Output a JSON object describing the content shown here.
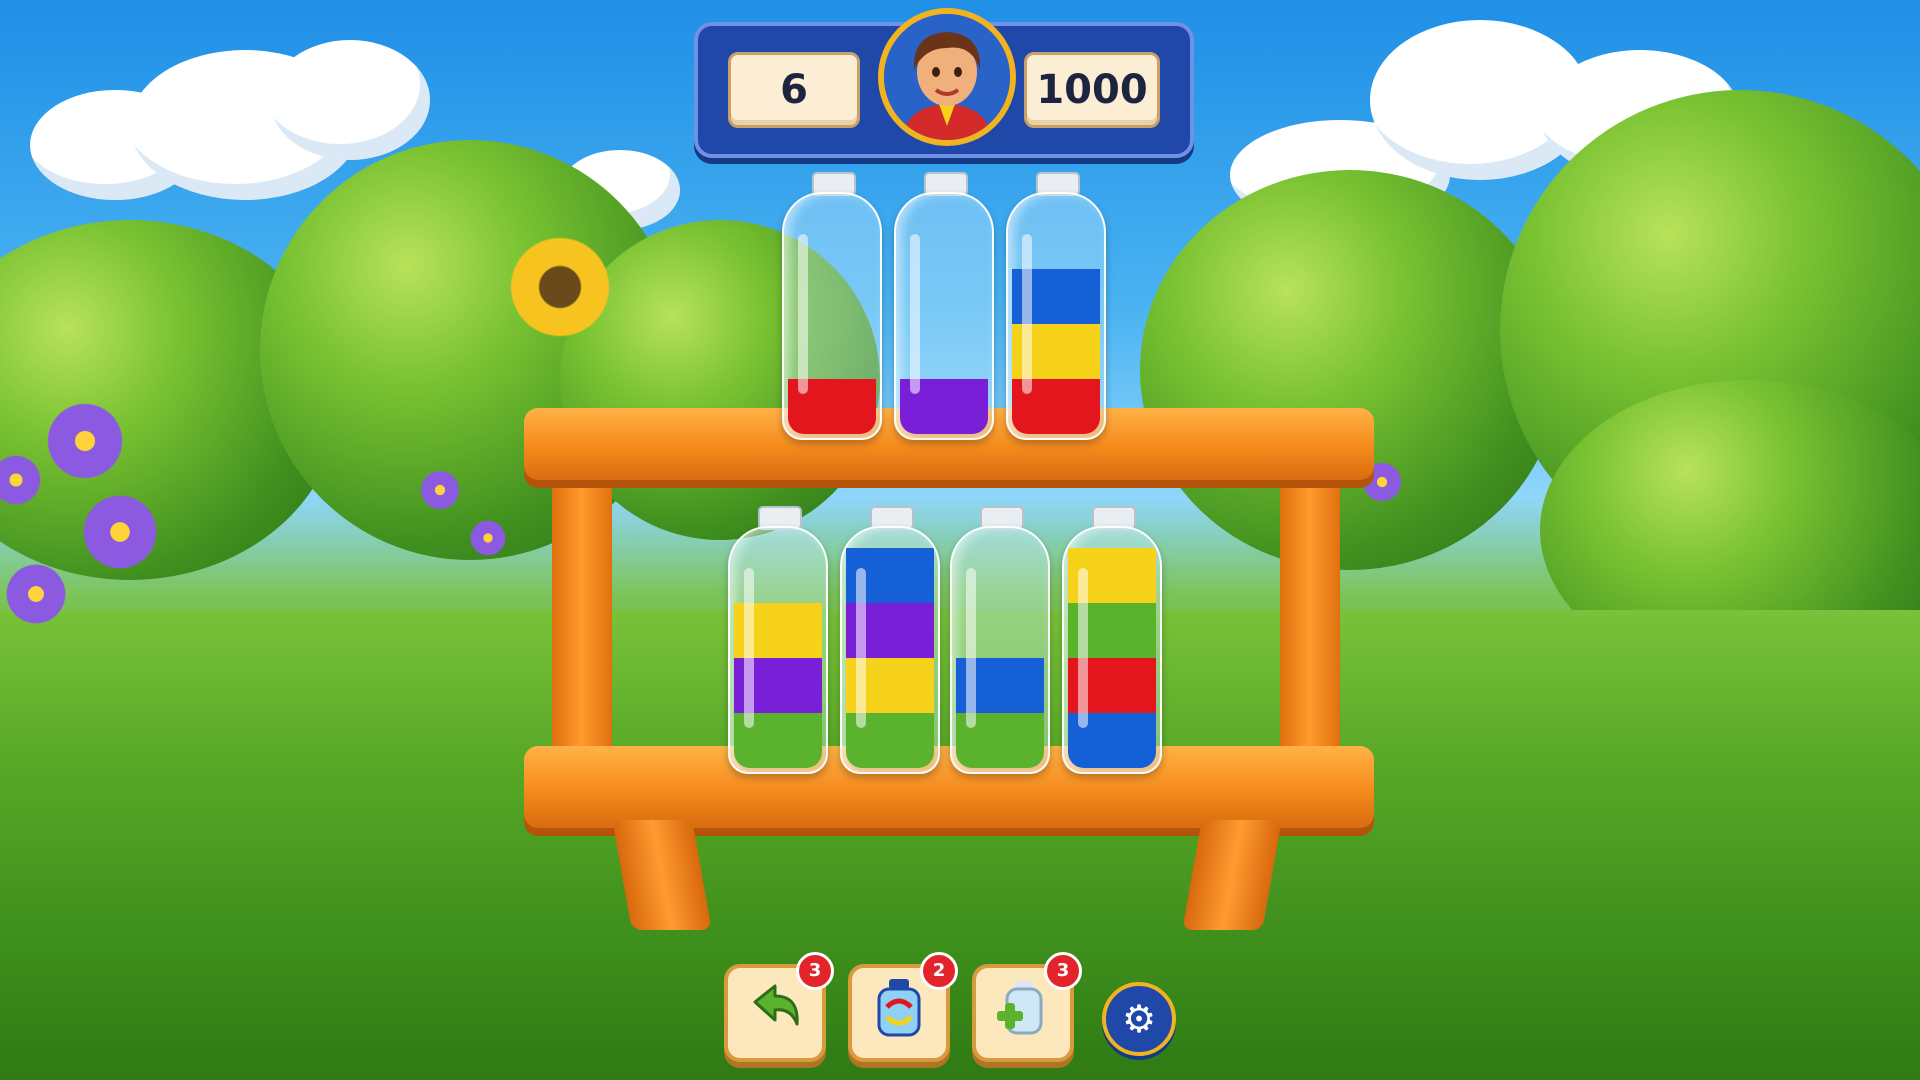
{
  "hud": {
    "moves": "6",
    "coins": "1000",
    "avatar_icon": "character-portrait-icon"
  },
  "colors": {
    "red": "#e3161d",
    "purple": "#7a1fd8",
    "blue": "#1560d6",
    "yellow": "#f6d21a",
    "green": "#5bb22d"
  },
  "shelves": {
    "top": [
      {
        "layers": [
          "red"
        ]
      },
      {
        "layers": [
          "purple"
        ]
      },
      {
        "layers": [
          "red",
          "yellow",
          "blue"
        ]
      }
    ],
    "bottom": [
      {
        "layers": [
          "green",
          "purple",
          "yellow"
        ]
      },
      {
        "layers": [
          "green",
          "yellow",
          "purple",
          "blue"
        ]
      },
      {
        "layers": [
          "green",
          "blue"
        ]
      },
      {
        "layers": [
          "blue",
          "red",
          "green",
          "yellow"
        ]
      }
    ]
  },
  "toolbar": {
    "undo": {
      "icon": "undo-arrow-icon",
      "count": "3"
    },
    "shuffle": {
      "icon": "shuffle-jar-icon",
      "count": "2"
    },
    "add_bottle": {
      "icon": "add-bottle-icon",
      "count": "3"
    },
    "settings": {
      "icon": "gear-icon"
    }
  }
}
